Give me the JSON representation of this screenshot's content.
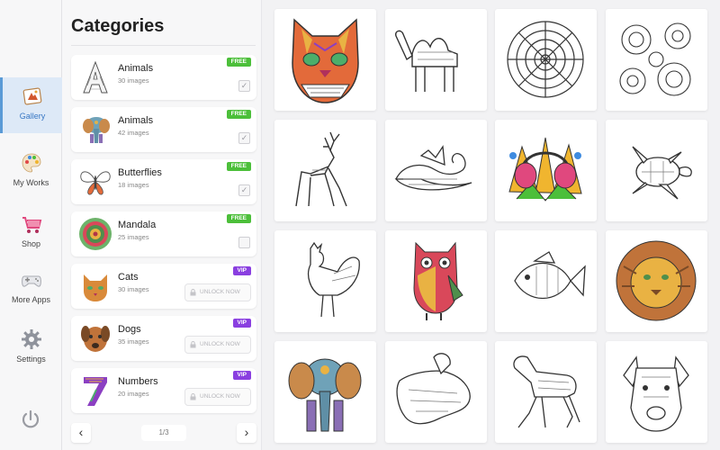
{
  "nav": {
    "items": [
      {
        "label": "Gallery",
        "icon": "gallery-icon",
        "active": true
      },
      {
        "label": "My Works",
        "icon": "palette-icon",
        "active": false
      },
      {
        "label": "Shop",
        "icon": "shopping-cart-icon",
        "active": false
      },
      {
        "label": "More Apps",
        "icon": "gamepad-icon",
        "active": false
      },
      {
        "label": "Settings",
        "icon": "gear-icon",
        "active": false
      }
    ],
    "power_icon": "power-icon"
  },
  "categories": {
    "title": "Categories",
    "items": [
      {
        "name": "Animals",
        "count": "30 images",
        "badge": "FREE",
        "checked": true,
        "thumb": "letter-a-thumb"
      },
      {
        "name": "Animals",
        "count": "42 images",
        "badge": "FREE",
        "checked": true,
        "thumb": "elephant-thumb"
      },
      {
        "name": "Butterflies",
        "count": "18 images",
        "badge": "FREE",
        "checked": true,
        "thumb": "butterfly-thumb"
      },
      {
        "name": "Mandala",
        "count": "25 images",
        "badge": "FREE",
        "checked": false,
        "thumb": "mandala-thumb"
      },
      {
        "name": "Cats",
        "count": "30 images",
        "badge": "VIP",
        "unlock": "UNLOCK NOW",
        "thumb": "cat-thumb"
      },
      {
        "name": "Dogs",
        "count": "35 images",
        "badge": "VIP",
        "unlock": "UNLOCK NOW",
        "thumb": "dog-thumb"
      },
      {
        "name": "Numbers",
        "count": "20 images",
        "badge": "VIP",
        "unlock": "UNLOCK NOW",
        "thumb": "number-seven-thumb"
      }
    ],
    "pager": {
      "label": "1/3",
      "prev": "‹",
      "next": "›"
    }
  },
  "colors": {
    "free": "#4cbf3a",
    "vip": "#8a3fe0",
    "active_nav": "#dde9f7",
    "active_text": "#3877c4"
  },
  "gallery": {
    "tiles": [
      "colored-cat-mask",
      "camel",
      "mandala-flower",
      "flower-pattern",
      "deer",
      "swan",
      "colored-headphones",
      "sea-turtle",
      "rooster",
      "colored-owl",
      "fish",
      "colored-lion",
      "colored-elephant",
      "dog-paw",
      "horse",
      "dog-face"
    ]
  }
}
